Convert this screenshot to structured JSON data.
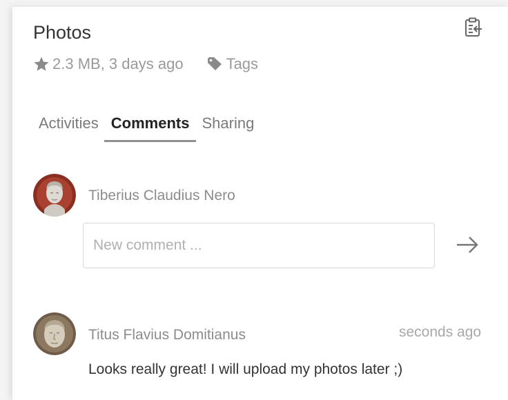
{
  "panel": {
    "title": "Photos",
    "meta": {
      "info": "2.3 MB, 3 days ago",
      "tags_label": "Tags"
    },
    "icons": {
      "favorite": "star-icon",
      "tags": "tag-icon",
      "action": "clipboard-export-icon",
      "send": "arrow-right-icon"
    }
  },
  "tabs": [
    {
      "label": "Activities",
      "active": false
    },
    {
      "label": "Comments",
      "active": true
    },
    {
      "label": "Sharing",
      "active": false
    }
  ],
  "new_comment": {
    "author": "Tiberius Claudius Nero",
    "placeholder": "New comment ..."
  },
  "comments": [
    {
      "author": "Titus Flavius Domitianus",
      "time": "seconds ago",
      "text": "Looks really great! I will upload my photos later ;)"
    }
  ],
  "colors": {
    "accent": "#8f8f8f",
    "muted": "#9a9a9a"
  }
}
